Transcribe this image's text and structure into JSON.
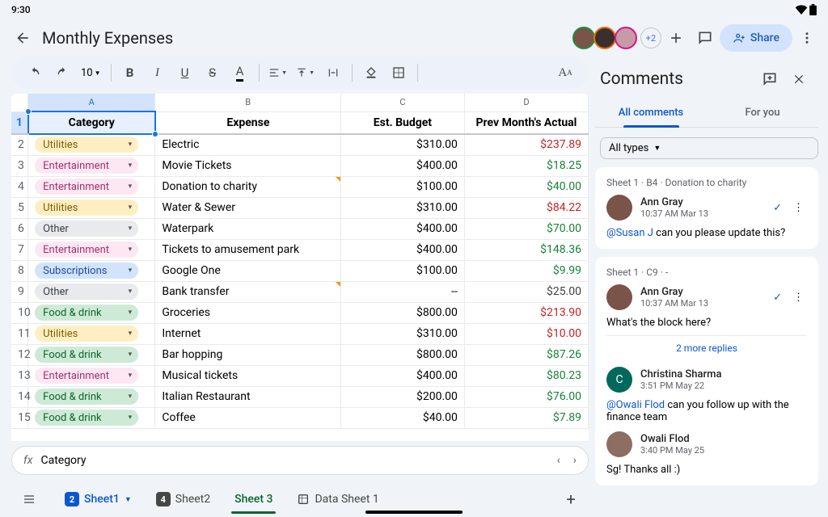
{
  "status": {
    "time": "9:30"
  },
  "header": {
    "title": "Monthly Expenses",
    "more_count": "+2",
    "share": "Share"
  },
  "toolbar": {
    "zoom": "10"
  },
  "columns": {
    "a": "A",
    "b": "B",
    "c": "C",
    "d": "D"
  },
  "headers": {
    "category": "Category",
    "expense": "Expense",
    "budget": "Est. Budget",
    "prev": "Prev Month's Actual"
  },
  "rows": [
    {
      "n": "2",
      "cat": "Utilities",
      "cls": "Utilities",
      "exp": "Electric",
      "bud": "$310.00",
      "prev": "$237.89",
      "pc": "neg"
    },
    {
      "n": "3",
      "cat": "Entertainment",
      "cls": "Entertainment",
      "exp": "Movie Tickets",
      "bud": "$400.00",
      "prev": "$18.25",
      "pc": "pos"
    },
    {
      "n": "4",
      "cat": "Entertainment",
      "cls": "Entertainment",
      "exp": "Donation to charity",
      "bud": "$100.00",
      "prev": "$40.00",
      "pc": "pos",
      "mark": true
    },
    {
      "n": "5",
      "cat": "Utilities",
      "cls": "Utilities",
      "exp": "Water & Sewer",
      "bud": "$310.00",
      "prev": "$84.22",
      "pc": "neg"
    },
    {
      "n": "6",
      "cat": "Other",
      "cls": "Other",
      "exp": "Waterpark",
      "bud": "$400.00",
      "prev": "$70.00",
      "pc": "pos"
    },
    {
      "n": "7",
      "cat": "Entertainment",
      "cls": "Entertainment",
      "exp": "Tickets to amusement park",
      "bud": "$400.00",
      "prev": "$148.36",
      "pc": "pos"
    },
    {
      "n": "8",
      "cat": "Subscriptions",
      "cls": "Subscriptions",
      "exp": "Google One",
      "bud": "$100.00",
      "prev": "$9.99",
      "pc": "pos"
    },
    {
      "n": "9",
      "cat": "Other",
      "cls": "Other",
      "exp": "Bank transfer",
      "bud": "--",
      "prev": "$25.00",
      "pc": "neu",
      "mark": true
    },
    {
      "n": "10",
      "cat": "Food & drink",
      "cls": "Food",
      "exp": "Groceries",
      "bud": "$800.00",
      "prev": "$213.90",
      "pc": "neg"
    },
    {
      "n": "11",
      "cat": "Utilities",
      "cls": "Utilities",
      "exp": "Internet",
      "bud": "$310.00",
      "prev": "$10.00",
      "pc": "neg"
    },
    {
      "n": "12",
      "cat": "Food & drink",
      "cls": "Food",
      "exp": "Bar hopping",
      "bud": "$800.00",
      "prev": "$87.26",
      "pc": "pos"
    },
    {
      "n": "13",
      "cat": "Entertainment",
      "cls": "Entertainment",
      "exp": "Musical tickets",
      "bud": "$400.00",
      "prev": "$80.23",
      "pc": "pos"
    },
    {
      "n": "14",
      "cat": "Food & drink",
      "cls": "Food",
      "exp": "Italian Restaurant",
      "bud": "$200.00",
      "prev": "$76.00",
      "pc": "pos"
    },
    {
      "n": "15",
      "cat": "Food & drink",
      "cls": "Food",
      "exp": "Coffee",
      "bud": "$40.00",
      "prev": "$7.89",
      "pc": "pos"
    }
  ],
  "fx": {
    "label": "Category"
  },
  "sheets": {
    "s1": "Sheet1",
    "s1b": "2",
    "s2": "Sheet2",
    "s2b": "4",
    "s3": "Sheet 3",
    "s4": "Data Sheet 1"
  },
  "comments": {
    "title": "Comments",
    "tab1": "All comments",
    "tab2": "For you",
    "filter": "All types",
    "c1": {
      "ref": "Sheet 1 · B4 · Donation to charity",
      "name": "Ann Gray",
      "time": "10:37 AM Mar 13",
      "mention": "@Susan J",
      "text": " can you please update this?"
    },
    "c2": {
      "ref": "Sheet 1 · C9 · -",
      "name": "Ann Gray",
      "time": "10:37 AM Mar 13",
      "text": "What's the block here?",
      "more": "2 more replies",
      "r1name": "Christina Sharma",
      "r1time": "3:51 PM May 22",
      "r1mention": "@Owali Flod",
      "r1text": " can you follow up with the finance team",
      "r2name": "Owali Flod",
      "r2time": "3:40 PM May 25",
      "r2text": "Sg! Thanks all :)"
    }
  }
}
